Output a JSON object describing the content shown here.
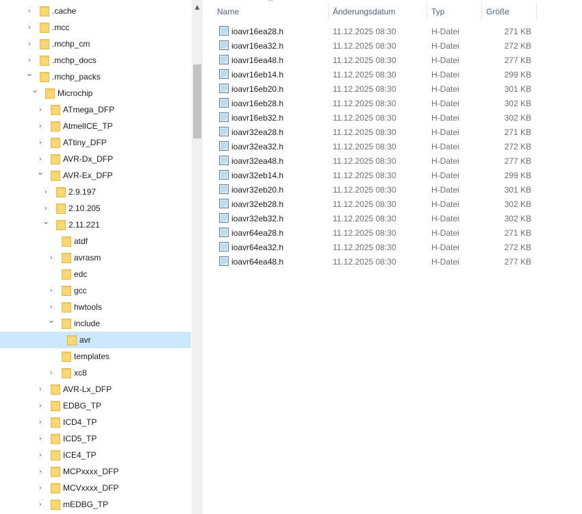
{
  "tree": {
    "items": [
      {
        "label": ".cache",
        "expander": "collapsed",
        "level": 0
      },
      {
        "label": ".mcc",
        "expander": "collapsed",
        "level": 0
      },
      {
        "label": ".mchp_cm",
        "expander": "collapsed",
        "level": 0
      },
      {
        "label": ".mchp_docs",
        "expander": "collapsed",
        "level": 0
      },
      {
        "label": ".mchp_packs",
        "expander": "expanded",
        "level": 0
      },
      {
        "label": "Microchip",
        "expander": "expanded",
        "level": 1
      },
      {
        "label": "ATmega_DFP",
        "expander": "collapsed",
        "level": 2
      },
      {
        "label": "AtmelICE_TP",
        "expander": "collapsed",
        "level": 2
      },
      {
        "label": "ATtiny_DFP",
        "expander": "collapsed",
        "level": 2
      },
      {
        "label": "AVR-Dx_DFP",
        "expander": "collapsed",
        "level": 2
      },
      {
        "label": "AVR-Ex_DFP",
        "expander": "expanded",
        "level": 2
      },
      {
        "label": "2.9.197",
        "expander": "collapsed",
        "level": 3
      },
      {
        "label": "2.10.205",
        "expander": "collapsed",
        "level": 3
      },
      {
        "label": "2.11.221",
        "expander": "expanded",
        "level": 3
      },
      {
        "label": "atdf",
        "expander": "none",
        "level": 4
      },
      {
        "label": "avrasm",
        "expander": "collapsed",
        "level": 4
      },
      {
        "label": "edc",
        "expander": "none",
        "level": 4
      },
      {
        "label": "gcc",
        "expander": "collapsed",
        "level": 4
      },
      {
        "label": "hwtools",
        "expander": "collapsed",
        "level": 4
      },
      {
        "label": "include",
        "expander": "expanded",
        "level": 4
      },
      {
        "label": "avr",
        "expander": "none",
        "level": 5,
        "selected": true
      },
      {
        "label": "templates",
        "expander": "none",
        "level": 4
      },
      {
        "label": "xc8",
        "expander": "collapsed",
        "level": 4
      },
      {
        "label": "AVR-Lx_DFP",
        "expander": "collapsed",
        "level": 2
      },
      {
        "label": "EDBG_TP",
        "expander": "collapsed",
        "level": 2
      },
      {
        "label": "ICD4_TP",
        "expander": "collapsed",
        "level": 2
      },
      {
        "label": "ICD5_TP",
        "expander": "collapsed",
        "level": 2
      },
      {
        "label": "ICE4_TP",
        "expander": "collapsed",
        "level": 2
      },
      {
        "label": "MCPxxxx_DFP",
        "expander": "collapsed",
        "level": 2
      },
      {
        "label": "MCVxxxx_DFP",
        "expander": "collapsed",
        "level": 2
      },
      {
        "label": "mEDBG_TP",
        "expander": "collapsed",
        "level": 2
      }
    ]
  },
  "columns": {
    "name": "Name",
    "date": "Änderungsdatum",
    "type": "Typ",
    "size": "Größe"
  },
  "files": [
    {
      "name": "ioavr16ea28.h",
      "date": "11.12.2025 08:30",
      "type": "H-Datei",
      "size": "271 KB"
    },
    {
      "name": "ioavr16ea32.h",
      "date": "11.12.2025 08:30",
      "type": "H-Datei",
      "size": "272 KB"
    },
    {
      "name": "ioavr16ea48.h",
      "date": "11.12.2025 08:30",
      "type": "H-Datei",
      "size": "277 KB"
    },
    {
      "name": "ioavr16eb14.h",
      "date": "11.12.2025 08:30",
      "type": "H-Datei",
      "size": "299 KB"
    },
    {
      "name": "ioavr16eb20.h",
      "date": "11.12.2025 08:30",
      "type": "H-Datei",
      "size": "301 KB"
    },
    {
      "name": "ioavr16eb28.h",
      "date": "11.12.2025 08:30",
      "type": "H-Datei",
      "size": "302 KB"
    },
    {
      "name": "ioavr16eb32.h",
      "date": "11.12.2025 08:30",
      "type": "H-Datei",
      "size": "302 KB"
    },
    {
      "name": "ioavr32ea28.h",
      "date": "11.12.2025 08:30",
      "type": "H-Datei",
      "size": "271 KB"
    },
    {
      "name": "ioavr32ea32.h",
      "date": "11.12.2025 08:30",
      "type": "H-Datei",
      "size": "272 KB"
    },
    {
      "name": "ioavr32ea48.h",
      "date": "11.12.2025 08:30",
      "type": "H-Datei",
      "size": "277 KB"
    },
    {
      "name": "ioavr32eb14.h",
      "date": "11.12.2025 08:30",
      "type": "H-Datei",
      "size": "299 KB"
    },
    {
      "name": "ioavr32eb20.h",
      "date": "11.12.2025 08:30",
      "type": "H-Datei",
      "size": "301 KB"
    },
    {
      "name": "ioavr32eb28.h",
      "date": "11.12.2025 08:30",
      "type": "H-Datei",
      "size": "302 KB"
    },
    {
      "name": "ioavr32eb32.h",
      "date": "11.12.2025 08:30",
      "type": "H-Datei",
      "size": "302 KB"
    },
    {
      "name": "ioavr64ea28.h",
      "date": "11.12.2025 08:30",
      "type": "H-Datei",
      "size": "271 KB"
    },
    {
      "name": "ioavr64ea32.h",
      "date": "11.12.2025 08:30",
      "type": "H-Datei",
      "size": "272 KB"
    },
    {
      "name": "ioavr64ea48.h",
      "date": "11.12.2025 08:30",
      "type": "H-Datei",
      "size": "277 KB"
    }
  ],
  "icons": {
    "folder": "folder-icon",
    "file": "header-file-icon",
    "expand": "chevron-right-icon",
    "collapse": "chevron-down-icon",
    "sort": "sort-ascending-icon"
  },
  "colors": {
    "selection": "#cce8ff",
    "folder": "#f8d775",
    "header_text": "#4c607a"
  }
}
